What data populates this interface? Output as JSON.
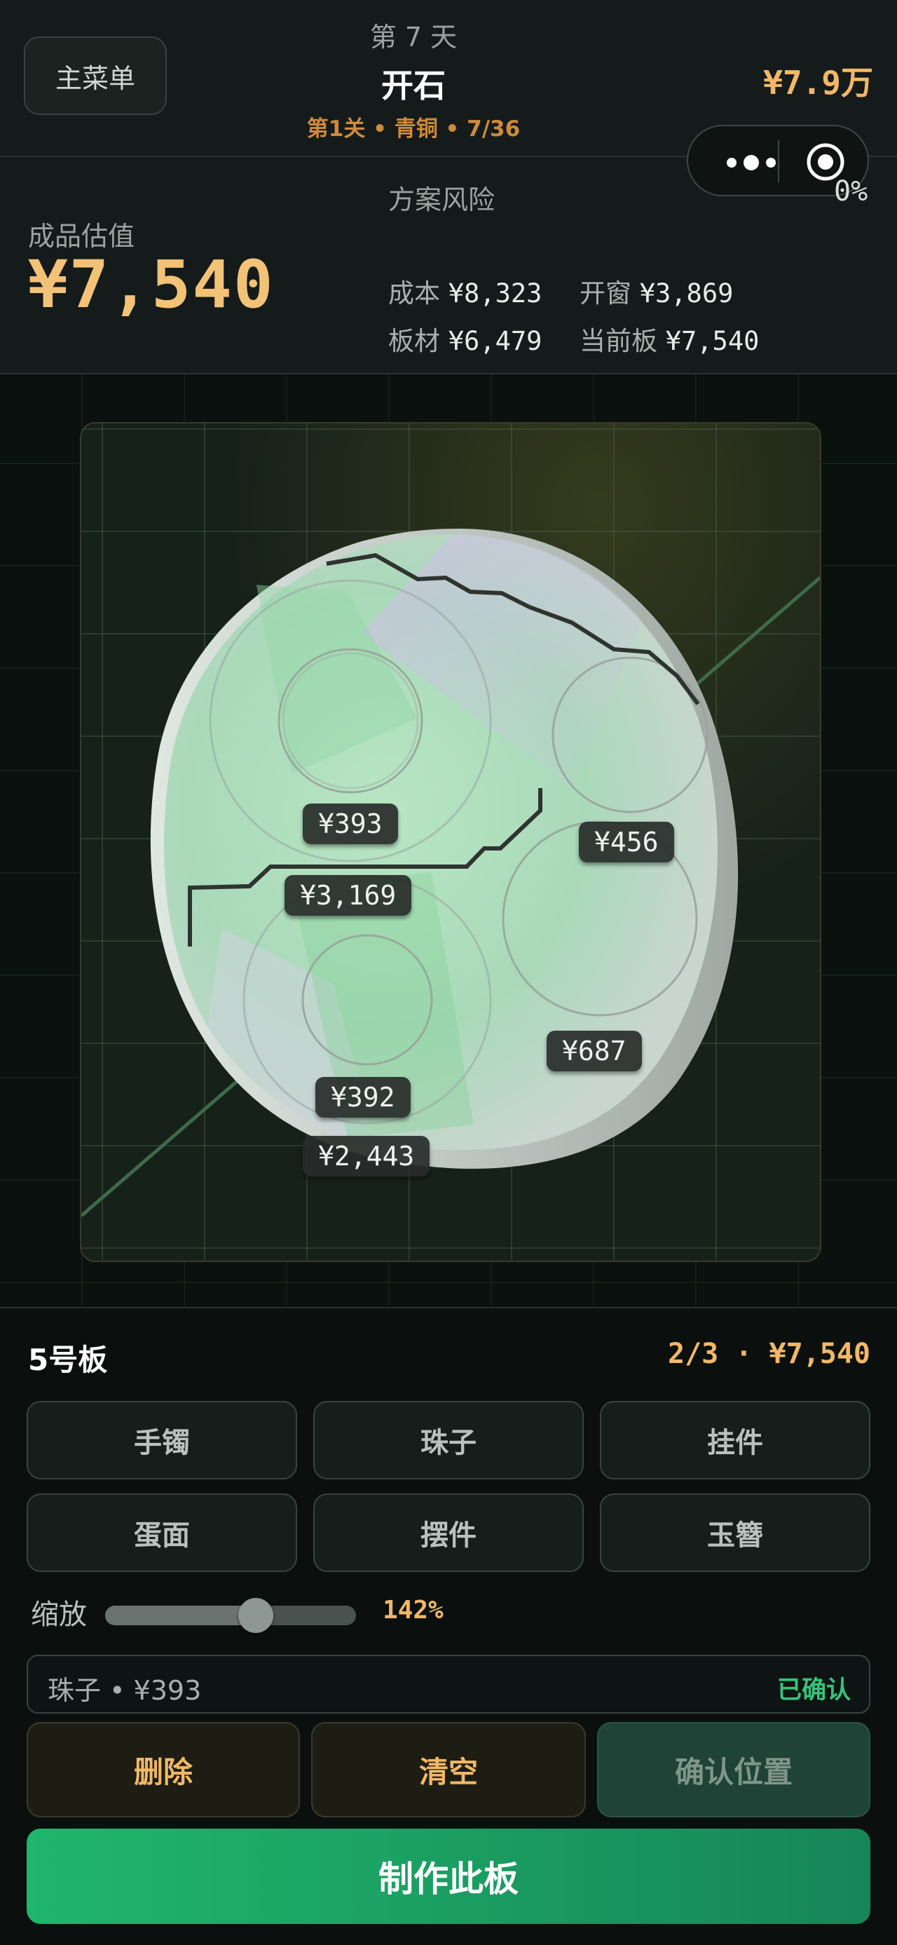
{
  "header": {
    "menu_label": "主菜单",
    "day_label": "第 7 天",
    "mode_title": "开石",
    "level_info": "第1关 • 青铜 • 7/36",
    "money": "¥7.9万"
  },
  "capsule": {
    "more_icon": "more-dots-icon",
    "close_icon": "target-circle-icon"
  },
  "stats": {
    "estimate_label": "成品估值",
    "estimate_value": "¥7,540",
    "risk_label": "方案风险",
    "risk_percent": "0%",
    "cost_label": "成本",
    "cost_value": "¥8,323",
    "window_label": "开窗",
    "window_value": "¥3,869",
    "board_label": "板材",
    "board_value": "¥6,479",
    "current_board_label": "当前板",
    "current_board_value": "¥7,540"
  },
  "stone": {
    "tags": [
      {
        "name": "price-tag-393",
        "label": "¥393"
      },
      {
        "name": "price-tag-456",
        "label": "¥456"
      },
      {
        "name": "price-tag-3169",
        "label": "¥3,169"
      },
      {
        "name": "price-tag-687",
        "label": "¥687"
      },
      {
        "name": "price-tag-392",
        "label": "¥392"
      },
      {
        "name": "price-tag-2443",
        "label": "¥2,443"
      }
    ]
  },
  "panel": {
    "board_name": "5号板",
    "board_count": "2/3 · ¥7,540",
    "types": [
      "手镯",
      "珠子",
      "挂件",
      "蛋面",
      "摆件",
      "玉簪"
    ],
    "zoom_label": "缩放",
    "zoom_value": "142%",
    "zoom_fraction": 0.6,
    "selected_text": "珠子 • ¥393",
    "selected_status": "已确认",
    "delete_label": "删除",
    "clear_label": "清空",
    "confirm_label": "确认位置",
    "make_label": "制作此板"
  },
  "colors": {
    "accent_gold": "#f2b866",
    "accent_green": "#20b66c",
    "confirmed_green": "#35c47a",
    "level_orange": "#d08a3a"
  }
}
